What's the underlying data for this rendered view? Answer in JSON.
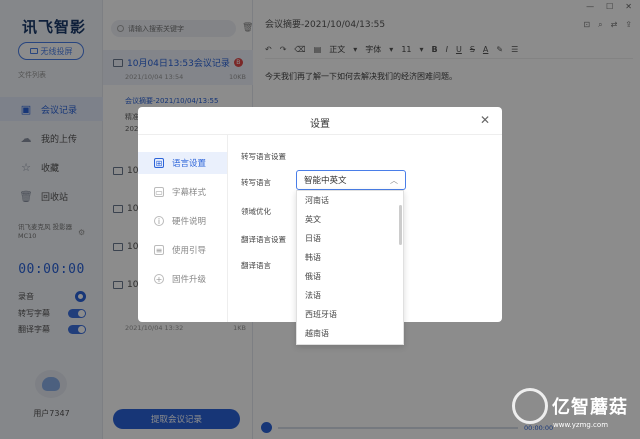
{
  "app": {
    "logo": "讯飞智影"
  },
  "sidebar": {
    "cast_label": "无线投屏",
    "file_list_label": "文件列表",
    "items": [
      {
        "label": "会议记录",
        "active": true
      },
      {
        "label": "我的上传",
        "active": false
      },
      {
        "label": "收藏",
        "active": false
      },
      {
        "label": "回收站",
        "active": false
      }
    ],
    "device": "讯飞麦克风 投影器MC10",
    "timer": "00:00:00",
    "controls": [
      {
        "label": "录音"
      },
      {
        "label": "转写字幕"
      },
      {
        "label": "翻译字幕"
      }
    ],
    "user": "用户7347"
  },
  "list": {
    "search_placeholder": "请输入搜索关键字",
    "selected": {
      "title": "10月04日13:53会议记录",
      "date": "2021/10/04 13:54",
      "size": "10KB",
      "badge": "B",
      "sub_link": "会议摘要-2021/10/04/13:55",
      "sub_texts": [
        "精准",
        "2021"
      ]
    },
    "folders": [
      {
        "label": "10"
      },
      {
        "label": "10"
      },
      {
        "label": "10"
      },
      {
        "label": "10"
      }
    ],
    "last_item": {
      "date": "2021/10/04 13:32",
      "size": "1KB"
    },
    "extract_button": "提取会议记录"
  },
  "editor": {
    "title": "会议摘要-2021/10/04/13:55",
    "body": "今天我们再了解一下如何去解决我们的经济困难问题。",
    "toolbar": {
      "para": "正文",
      "font": "字体",
      "size": "11",
      "bold": "B",
      "italic": "I",
      "underline": "U",
      "strike": "S",
      "color": "A"
    },
    "player_time": "00:00:00"
  },
  "modal": {
    "title": "设置",
    "close": "✕",
    "nav": [
      {
        "label": "语言设置",
        "active": true
      },
      {
        "label": "字幕样式",
        "active": false
      },
      {
        "label": "硬件说明",
        "active": false
      },
      {
        "label": "使用引导",
        "active": false
      },
      {
        "label": "固件升级",
        "active": false
      }
    ],
    "section_transcribe": "转写语言设置",
    "transcribe_lang_label": "转写语言",
    "transcribe_lang_value": "智能中英文",
    "domain_label": "领域优化",
    "section_translate": "翻译语言设置",
    "translate_lang_label": "翻译语言"
  },
  "dropdown": {
    "options": [
      "河南话",
      "英文",
      "日语",
      "韩语",
      "俄语",
      "法语",
      "西班牙语",
      "越南语"
    ]
  },
  "watermark": {
    "text": "亿智蘑菇",
    "url": "www.yzmg.com"
  }
}
